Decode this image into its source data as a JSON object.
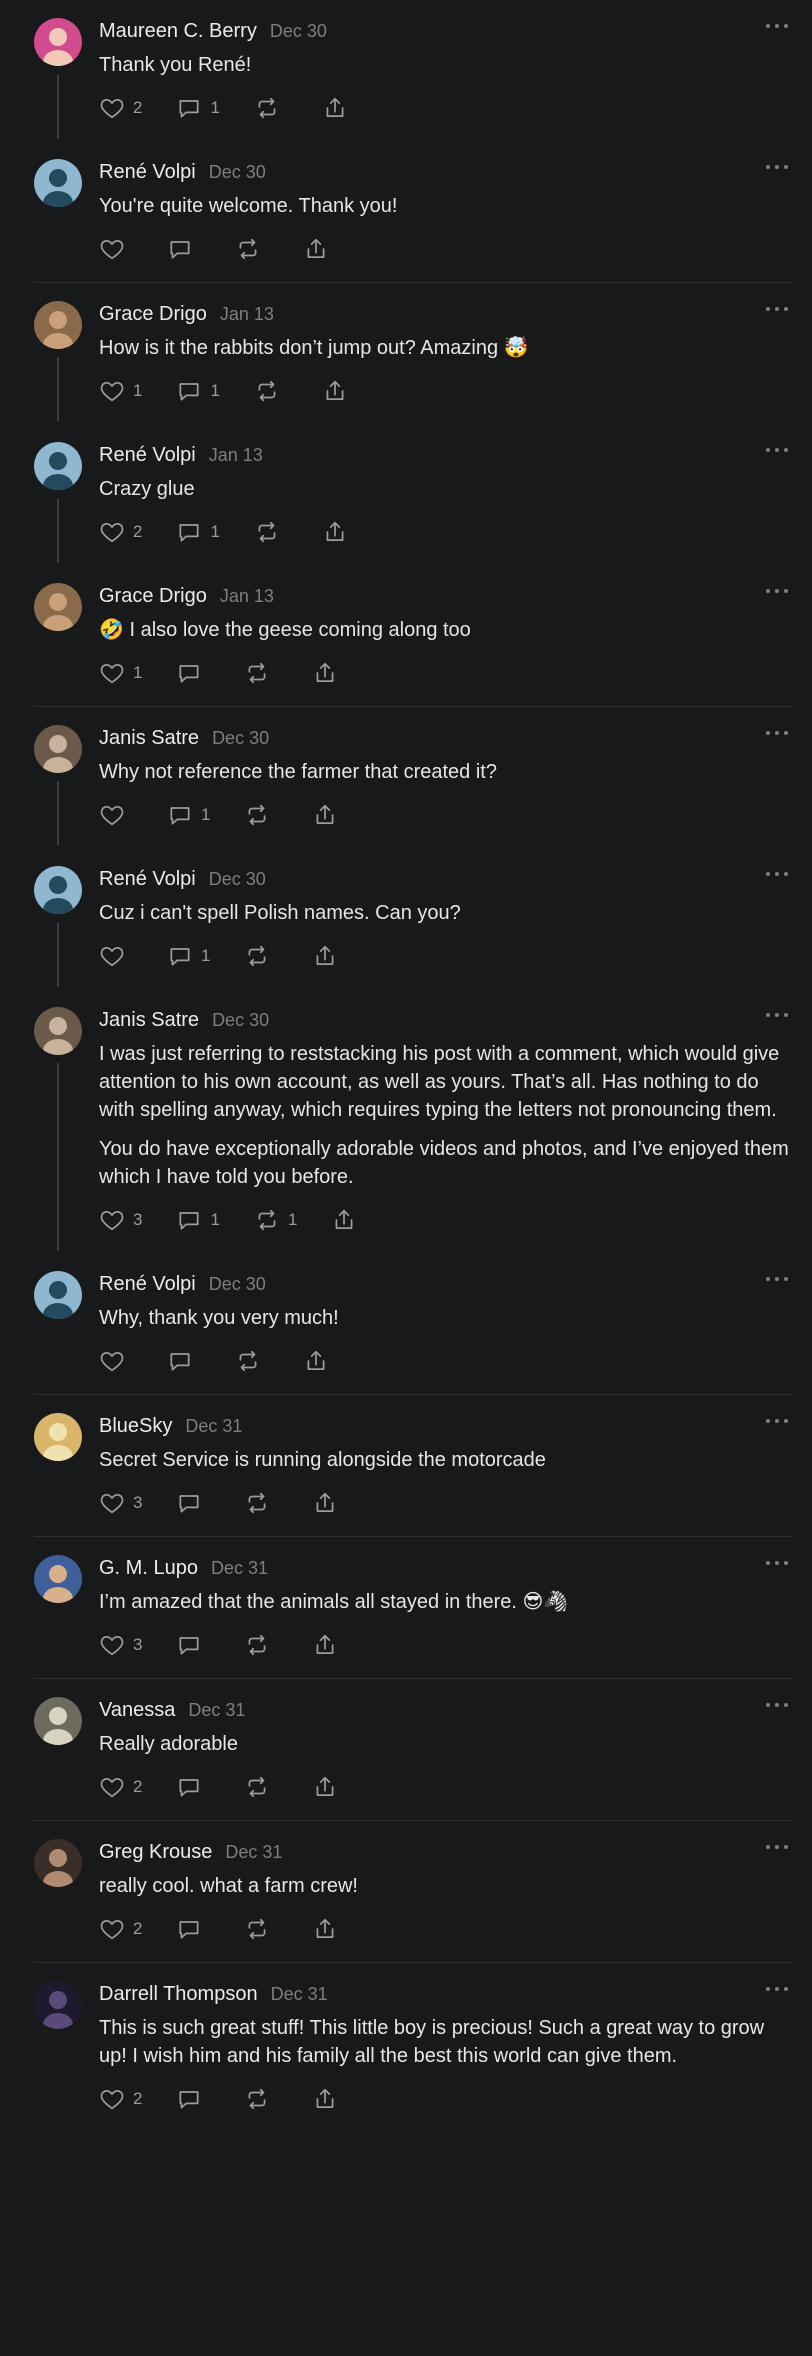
{
  "posts": [
    {
      "id": "p1",
      "author": "Maureen C. Berry",
      "date": "Dec 30",
      "paragraphs": [
        "Thank you René!"
      ],
      "likes": "2",
      "replies": "1",
      "reposts": "",
      "thread_below": true,
      "divider_after": false,
      "avatar": {
        "bg": "#d34b8f",
        "fg": "#f2c9b8"
      }
    },
    {
      "id": "p2",
      "author": "René Volpi",
      "date": "Dec 30",
      "paragraphs": [
        "You're quite welcome. Thank you!"
      ],
      "likes": "",
      "replies": "",
      "reposts": "",
      "thread_below": false,
      "divider_after": true,
      "avatar": {
        "bg": "#8fb8d0",
        "fg": "#244a5e"
      }
    },
    {
      "id": "p3",
      "author": "Grace Drigo",
      "date": "Jan 13",
      "paragraphs": [
        "How is it the rabbits don’t jump out? Amazing 🤯"
      ],
      "likes": "1",
      "replies": "1",
      "reposts": "",
      "thread_below": true,
      "divider_after": false,
      "avatar": {
        "bg": "#8a6a4a",
        "fg": "#c9a07a"
      }
    },
    {
      "id": "p4",
      "author": "René Volpi",
      "date": "Jan 13",
      "paragraphs": [
        "Crazy glue"
      ],
      "likes": "2",
      "replies": "1",
      "reposts": "",
      "thread_below": true,
      "divider_after": false,
      "avatar": {
        "bg": "#8fb8d0",
        "fg": "#244a5e"
      }
    },
    {
      "id": "p5",
      "author": "Grace Drigo",
      "date": "Jan 13",
      "paragraphs": [
        "🤣 I also love the geese coming along too"
      ],
      "likes": "1",
      "replies": "",
      "reposts": "",
      "thread_below": false,
      "divider_after": true,
      "avatar": {
        "bg": "#8a6a4a",
        "fg": "#c9a07a"
      }
    },
    {
      "id": "p6",
      "author": "Janis Satre",
      "date": "Dec 30",
      "paragraphs": [
        "Why not reference the farmer that created it?"
      ],
      "likes": "",
      "replies": "1",
      "reposts": "",
      "thread_below": true,
      "divider_after": false,
      "avatar": {
        "bg": "#6b5a4a",
        "fg": "#c8b39a"
      }
    },
    {
      "id": "p7",
      "author": "René Volpi",
      "date": "Dec 30",
      "paragraphs": [
        "Cuz i can't spell Polish names. Can you?"
      ],
      "likes": "",
      "replies": "1",
      "reposts": "",
      "thread_below": true,
      "divider_after": false,
      "avatar": {
        "bg": "#8fb8d0",
        "fg": "#244a5e"
      }
    },
    {
      "id": "p8",
      "author": "Janis Satre",
      "date": "Dec 30",
      "paragraphs": [
        "I was just referring to reststacking his post with a comment, which would give attention to his own account, as well as yours. That’s all. Has nothing to do with spelling anyway, which requires typing the letters not pronouncing them.",
        "You do have exceptionally adorable videos and photos, and I’ve enjoyed them which I have told you before."
      ],
      "likes": "3",
      "replies": "1",
      "reposts": "1",
      "thread_below": true,
      "divider_after": false,
      "avatar": {
        "bg": "#6b5a4a",
        "fg": "#c8b39a"
      }
    },
    {
      "id": "p9",
      "author": "René Volpi",
      "date": "Dec 30",
      "paragraphs": [
        "Why, thank you very much!"
      ],
      "likes": "",
      "replies": "",
      "reposts": "",
      "thread_below": false,
      "divider_after": true,
      "avatar": {
        "bg": "#8fb8d0",
        "fg": "#244a5e"
      }
    },
    {
      "id": "p10",
      "author": "BlueSky",
      "date": "Dec 31",
      "paragraphs": [
        "Secret Service is running alongside the motorcade"
      ],
      "likes": "3",
      "replies": "",
      "reposts": "",
      "thread_below": false,
      "divider_after": true,
      "avatar": {
        "bg": "#d9b56a",
        "fg": "#f0e2b0"
      }
    },
    {
      "id": "p11",
      "author": "G. M. Lupo",
      "date": "Dec 31",
      "paragraphs": [
        "I’m amazed that the animals all stayed in there. 😎🦓"
      ],
      "likes": "3",
      "replies": "",
      "reposts": "",
      "thread_below": false,
      "divider_after": true,
      "avatar": {
        "bg": "#3f5f9a",
        "fg": "#d9b08c"
      }
    },
    {
      "id": "p12",
      "author": "Vanessa",
      "date": "Dec 31",
      "paragraphs": [
        "Really adorable"
      ],
      "likes": "2",
      "replies": "",
      "reposts": "",
      "thread_below": false,
      "divider_after": true,
      "avatar": {
        "bg": "#6e6a5e",
        "fg": "#d8d2c0"
      }
    },
    {
      "id": "p13",
      "author": "Greg Krouse",
      "date": "Dec 31",
      "paragraphs": [
        "really cool. what a farm crew!"
      ],
      "likes": "2",
      "replies": "",
      "reposts": "",
      "thread_below": false,
      "divider_after": true,
      "avatar": {
        "bg": "#3a2e28",
        "fg": "#b08a6e"
      }
    },
    {
      "id": "p14",
      "author": "Darrell Thompson",
      "date": "Dec 31",
      "paragraphs": [
        "This is such great stuff! This little boy is precious! Such a great way to grow up! I wish him and his family all the best this world can give them."
      ],
      "likes": "2",
      "replies": "",
      "reposts": "",
      "thread_below": false,
      "divider_after": false,
      "avatar": {
        "bg": "#1e1a2e",
        "fg": "#5a4a7a"
      }
    }
  ],
  "icons": {
    "like": "heart-icon",
    "reply": "comment-icon",
    "repost": "repost-icon",
    "share": "share-icon",
    "more": "more-icon"
  },
  "colors": {
    "background": "#18191b",
    "text": "#e6e6e8",
    "muted": "#7d7e83",
    "divider": "#2e2f32"
  }
}
